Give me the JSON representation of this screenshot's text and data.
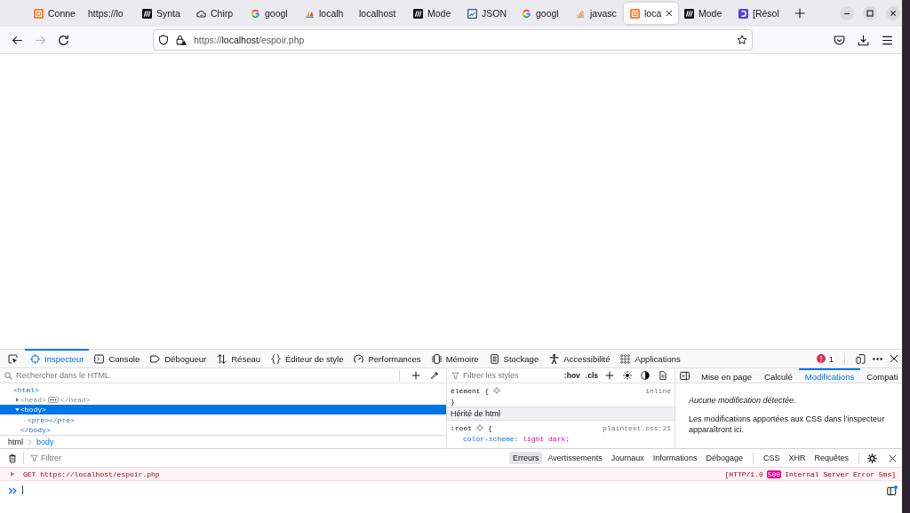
{
  "browser": {
    "tabs": [
      {
        "kind": "crate",
        "title": "Conne",
        "selected": false
      },
      {
        "kind": "plain",
        "title": "https://lo",
        "selected": false
      },
      {
        "kind": "mono",
        "title": "Synta",
        "selected": false
      },
      {
        "kind": "cloud",
        "title": "Chirp",
        "selected": false
      },
      {
        "kind": "ring",
        "title": "googl",
        "selected": false
      },
      {
        "kind": "sail",
        "title": "localh",
        "selected": false
      },
      {
        "kind": "plain",
        "title": "localhost",
        "selected": false
      },
      {
        "kind": "mono",
        "title": "Mode",
        "selected": false
      },
      {
        "kind": "chart",
        "title": "JSON",
        "selected": false
      },
      {
        "kind": "ring",
        "title": "googl",
        "selected": false
      },
      {
        "kind": "stack",
        "title": "javasc",
        "selected": false
      },
      {
        "kind": "crate",
        "title": "loca",
        "selected": true
      },
      {
        "kind": "mono",
        "title": "Mode",
        "selected": false
      },
      {
        "kind": "door",
        "title": "[Résol",
        "selected": false
      }
    ],
    "nav_buttons": [
      {
        "kind": "back",
        "disabled": false
      },
      {
        "kind": "forward",
        "disabled": true
      },
      {
        "kind": "reload",
        "disabled": false
      }
    ],
    "address": {
      "prefix": "https://",
      "host": "localhost",
      "path": "/espoir.php"
    }
  },
  "devtools": {
    "tabs": [
      {
        "kind": "inspector",
        "label": "Inspecteur",
        "selected": true
      },
      {
        "kind": "console",
        "label": "Console",
        "selected": false
      },
      {
        "kind": "debugger",
        "label": "Débogueur",
        "selected": false
      },
      {
        "kind": "network",
        "label": "Réseau",
        "selected": false
      },
      {
        "kind": "style",
        "label": "Éditeur de style",
        "selected": false
      },
      {
        "kind": "performance",
        "label": "Performances",
        "selected": false
      },
      {
        "kind": "memory",
        "label": "Mémoire",
        "selected": false
      },
      {
        "kind": "storage",
        "label": "Stockage",
        "selected": false
      },
      {
        "kind": "accessibility",
        "label": "Accessibilité",
        "selected": false
      },
      {
        "kind": "application",
        "label": "Applications",
        "selected": false
      }
    ],
    "error_count": "1",
    "inspector": {
      "search_placeholder": "Rechercher dans le HTML",
      "markup": [
        {
          "open": "<html>",
          "selected": false,
          "dimmed": false,
          "children": [
            {
              "open": "<head>",
              "close": "</head>",
              "expanded": false,
              "selected": false,
              "dimmed": true
            },
            {
              "open": "<body>",
              "close": "</body>",
              "expanded": true,
              "selected": true,
              "dimmed": false,
              "children": [
                {
                  "open": "<pre>",
                  "close": "</pre>",
                  "selected": false,
                  "dimmed": false
                }
              ]
            }
          ]
        }
      ],
      "breadcrumbs": [
        {
          "label": "html",
          "selected": false
        },
        {
          "label": "body",
          "selected": true
        }
      ]
    },
    "styles": {
      "filter_placeholder": "Filtrer les styles",
      "toggles": [
        ":hov",
        ".cls"
      ],
      "rules": [
        {
          "kind": "rule",
          "head": [
            {
              "kind": "text",
              "text": "élément {"
            },
            {
              "kind": "icon"
            }
          ],
          "source": "inline",
          "close": "}"
        },
        {
          "kind": "header",
          "label": "Hérité de html"
        },
        {
          "kind": "rule",
          "head": [
            {
              "kind": "text",
              "text": ":root"
            },
            {
              "kind": "icon"
            },
            {
              "kind": "text",
              "text": "{"
            }
          ],
          "source": "plaintext.css:21",
          "declarations": [
            {
              "property": "color-scheme:",
              "value": "light dark;"
            }
          ]
        }
      ]
    },
    "changes": {
      "tabs": [
        {
          "label": "Mise en page",
          "selected": false
        },
        {
          "label": "Calculé",
          "selected": false
        },
        {
          "label": "Modifications",
          "selected": true
        },
        {
          "label": "Compati",
          "selected": false
        }
      ],
      "empty_title": "Aucune modification détectée.",
      "empty_text": "Les modifications apportées aux CSS dans l’inspecteur apparaîtront ici."
    },
    "console": {
      "filter_placeholder": "Filtrer",
      "levels": [
        {
          "label": "Erreurs",
          "selected": true
        },
        {
          "label": "Avertissements",
          "selected": false
        },
        {
          "label": "Journaux",
          "selected": false
        },
        {
          "label": "Informations",
          "selected": false
        },
        {
          "label": "Débogage",
          "selected": false
        }
      ],
      "types": [
        {
          "label": "CSS",
          "selected": false
        },
        {
          "label": "XHR",
          "selected": false
        },
        {
          "label": "Requêtes",
          "selected": false
        }
      ],
      "messages": [
        {
          "kind": "error",
          "expanded": false,
          "text": "GET https://localhost/espoir.php",
          "protocol": "[HTTP/1.0",
          "status": "500",
          "status_text": "Internal Server Error 5ms]"
        }
      ]
    }
  }
}
